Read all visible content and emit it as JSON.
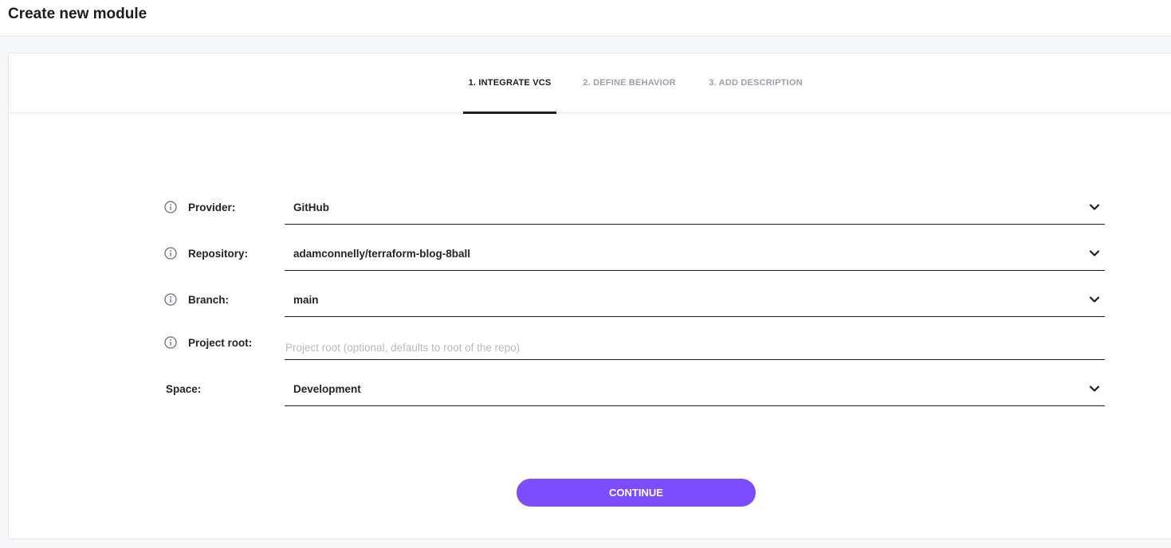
{
  "header": {
    "title": "Create new module"
  },
  "tabs": [
    {
      "label": "1. INTEGRATE VCS",
      "active": true
    },
    {
      "label": "2. DEFINE BEHAVIOR",
      "active": false
    },
    {
      "label": "3. ADD DESCRIPTION",
      "active": false
    }
  ],
  "form": {
    "provider": {
      "label": "Provider:",
      "value": "GitHub",
      "icon": "info-icon"
    },
    "repository": {
      "label": "Repository:",
      "value": "adamconnelly/terraform-blog-8ball",
      "icon": "info-icon"
    },
    "branch": {
      "label": "Branch:",
      "value": "main",
      "icon": "info-icon"
    },
    "project_root": {
      "label": "Project root:",
      "value": "",
      "placeholder": "Project root (optional, defaults to root of the repo)",
      "icon": "info-icon"
    },
    "space": {
      "label": "Space:",
      "value": "Development"
    }
  },
  "actions": {
    "continue_label": "CONTINUE"
  },
  "colors": {
    "accent": "#7c4dff",
    "text": "#1e1e24",
    "muted": "#9aa0a8"
  }
}
